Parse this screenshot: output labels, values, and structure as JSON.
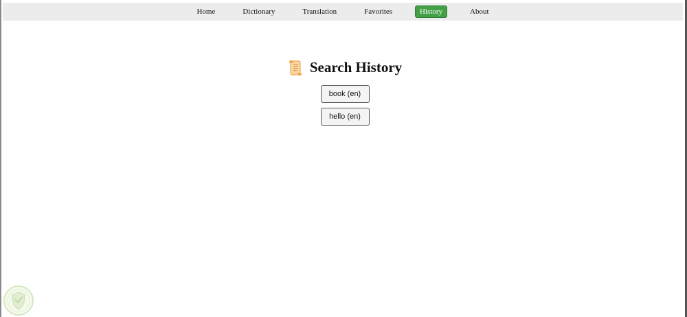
{
  "nav": {
    "items": [
      {
        "label": "Home"
      },
      {
        "label": "Dictionary"
      },
      {
        "label": "Translation"
      },
      {
        "label": "Favorites"
      },
      {
        "label": "History"
      },
      {
        "label": "About"
      }
    ],
    "active_index": 4,
    "active_color": "#43a047"
  },
  "header": {
    "icon": "scroll-icon",
    "title": "Search History"
  },
  "history": {
    "items": [
      {
        "label": "book (en)"
      },
      {
        "label": "hello (en)"
      }
    ]
  },
  "badge": {
    "icon": "shield-badge-icon"
  }
}
